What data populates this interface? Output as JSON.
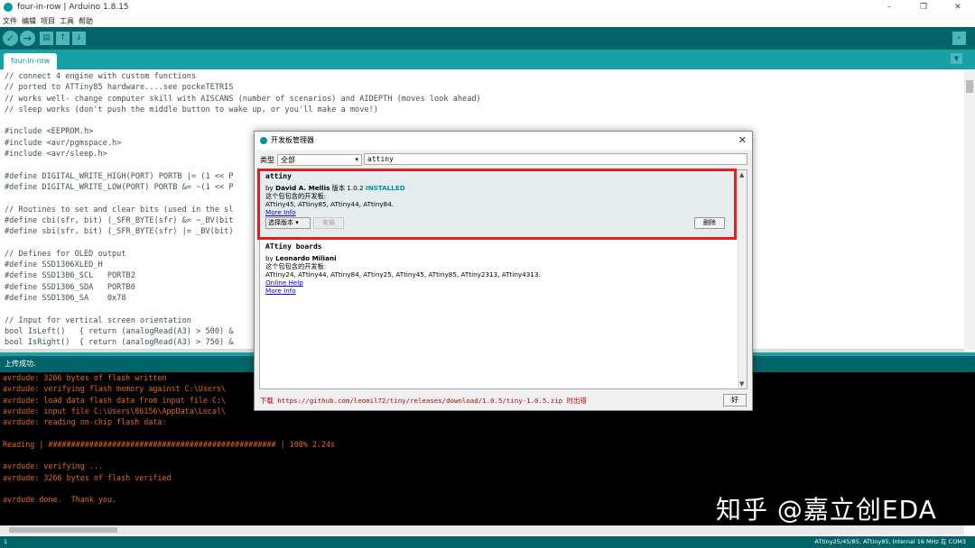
{
  "window": {
    "title": "four-in-row | Arduino 1.8.15",
    "min": "–",
    "max": "❐",
    "close": "✕"
  },
  "menu": [
    "文件",
    "编辑",
    "项目",
    "工具",
    "帮助"
  ],
  "toolbar": {
    "verify": "✓",
    "upload": "→",
    "new": "▤",
    "open": "↑",
    "save": "↓",
    "serial": "⌕"
  },
  "tab": {
    "label": "four-in-row",
    "menu": "▼"
  },
  "editor_lines": [
    "// connect 4 engine with custom functions",
    "// ported to ATTiny85 hardware....see pockeTETRIS",
    "// works well- change computer skill with AISCANS (number of scenarios) and AIDEPTH (moves look ahead)",
    "// sleep works (don't push the middle button to wake up, or you'll make a move!)",
    "",
    "#include <EEPROM.h>",
    "#include <avr/pgmspace.h>",
    "#include <avr/sleep.h>",
    "",
    "#define DIGITAL_WRITE_HIGH(PORT) PORTB |= (1 << P",
    "#define DIGITAL_WRITE_LOW(PORT) PORTB &= ~(1 << P",
    "",
    "// Routines to set and clear bits (used in the sl",
    "#define cbi(sfr, bit) (_SFR_BYTE(sfr) &= ~_BV(bit",
    "#define sbi(sfr, bit) (_SFR_BYTE(sfr) |= _BV(bit)",
    "",
    "// Defines for OLED output",
    "#define SSD1306XLED_H",
    "#define SSD1306_SCL   PORTB2",
    "#define SSD1306_SDA   PORTB0",
    "#define SSD1306_SA    0x78",
    "",
    "// Input for vertical screen orientation",
    "bool IsLeft()   { return (analogRead(A3) > 500) &",
    "bool IsRight()  { return (analogRead(A3) > 750) &"
  ],
  "status_message": "上传成功.",
  "console_lines": [
    "avrdude: 3266 bytes of flash written",
    "avrdude: verifying flash memory against C:\\Users\\",
    "avrdude: load data flash data from input file C:\\",
    "avrdude: input file C:\\Users\\86156\\AppData\\Local\\",
    "avrdude: reading on-chip flash data:",
    "",
    "Reading | ################################################## | 100% 2.24s",
    "",
    "avrdude: verifying ...",
    "avrdude: 3266 bytes of flash verified",
    "",
    "avrdude done.  Thank you."
  ],
  "bottom_status": {
    "line": "1",
    "board": "ATtiny25/45/85, ATtiny85, Internal 16 MHz 在 COM3"
  },
  "watermark": "知乎 @嘉立创EDA",
  "dialog": {
    "title": "开发板管理器",
    "close": "✕",
    "type_label": "类型",
    "type_value": "全部",
    "search_value": "attiny",
    "packages": [
      {
        "name": "attiny",
        "by": "by ",
        "author": "David A. Mellis",
        "version_text": " 版本 1.0.2 ",
        "installed": "INSTALLED",
        "boards_label": "这个包包含的开发板:",
        "boards": "ATtiny45, ATtiny85, ATtiny44, ATtiny84.",
        "more_info": "More Info",
        "version_select": "选择版本",
        "install": "安装",
        "remove": "删除"
      },
      {
        "name": "ATtiny boards",
        "by": "by ",
        "author": "Leonardo Miliani",
        "boards_label": "这个包包含的开发板:",
        "boards": "ATtiny24, ATtiny44, ATtiny84, ATtiny25, ATtiny45, ATtiny85, ATtiny2313, ATtiny4313.",
        "online_help": "Online Help",
        "more_info": "More Info"
      }
    ],
    "download_status": "下载 https://github.com/leomil72/tiny/releases/download/1.0.5/tiny-1.0.5.zip 时出错",
    "ok": "好"
  }
}
